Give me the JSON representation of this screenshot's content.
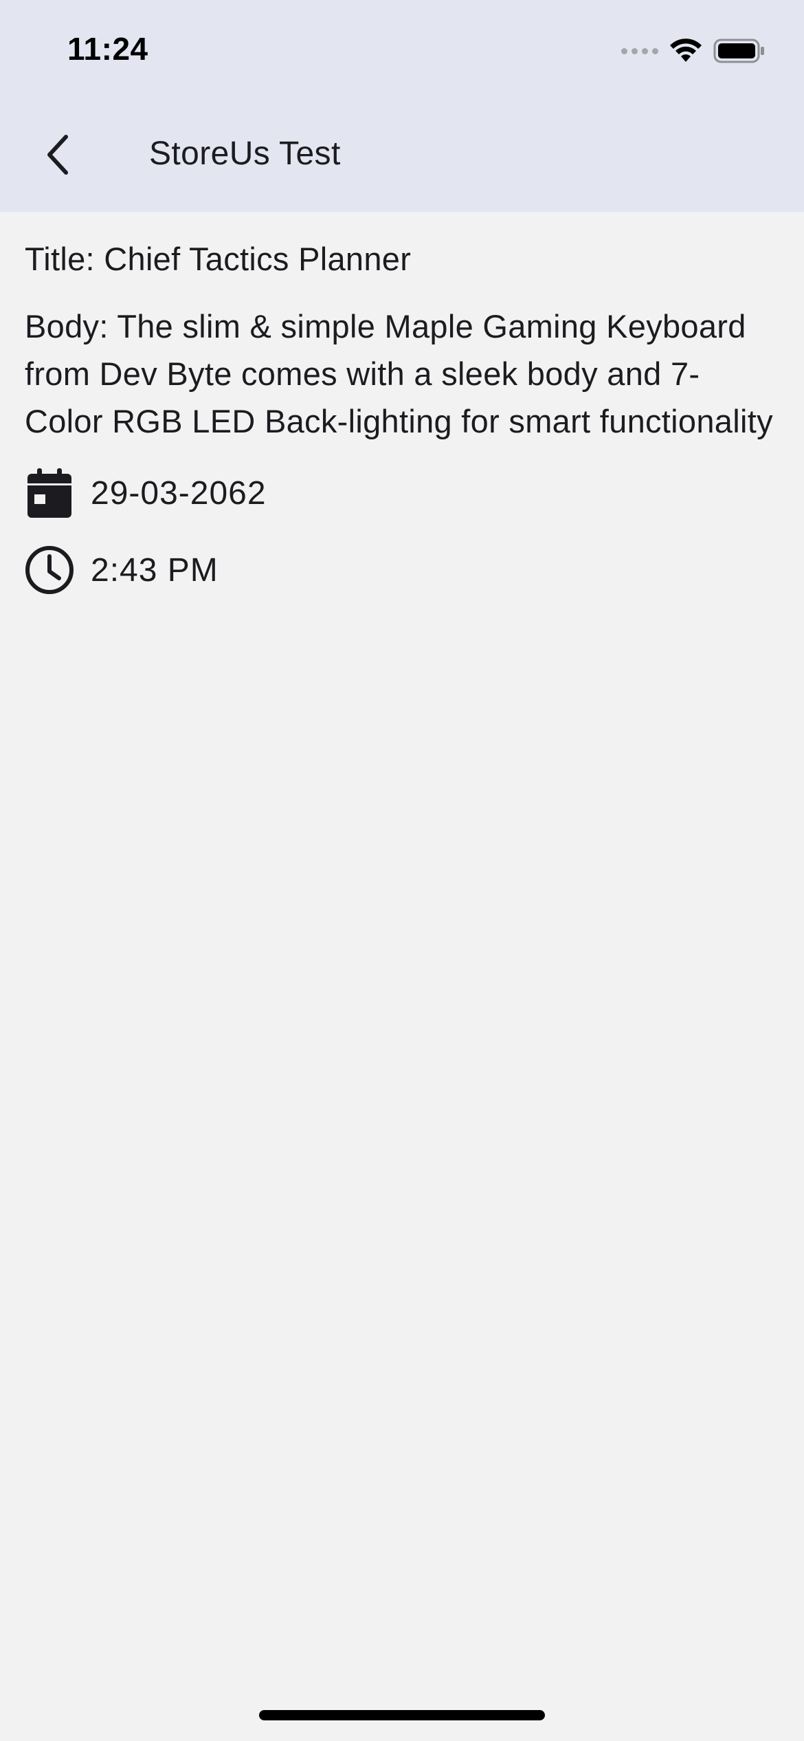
{
  "status_bar": {
    "time": "11:24",
    "icons": [
      "cellular-signal-icon",
      "wifi-icon",
      "battery-icon"
    ]
  },
  "app_bar": {
    "back_icon": "chevron-left-icon",
    "title": "StoreUs Test"
  },
  "detail": {
    "title": "Title: Chief Tactics Planner",
    "body": "Body: The slim & simple Maple Gaming Keyboard from Dev Byte comes with a sleek body and 7- Color RGB LED Back-lighting for smart functionality",
    "date_icon": "calendar-icon",
    "date": "29-03-2062",
    "time_icon": "clock-icon",
    "time": "2:43 PM"
  },
  "colors": {
    "app_bar_background": "#e3e5f1",
    "page_background": "#f2f2f2",
    "text": "#1c1b1f"
  }
}
